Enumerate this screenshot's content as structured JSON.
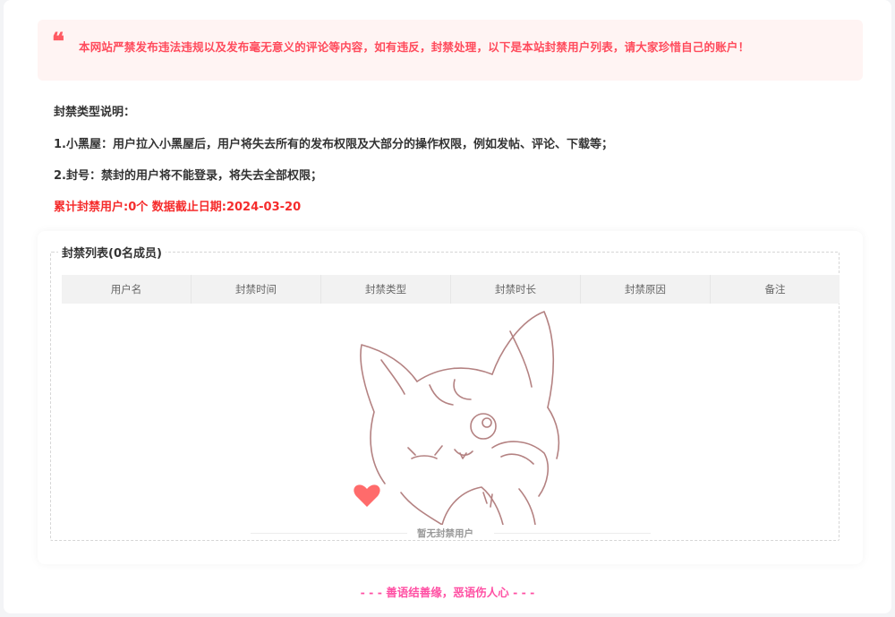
{
  "notice": {
    "icon": "quote-icon",
    "text": "本网站严禁发布违法违规以及发布毫无意义的评论等内容，如有违反，封禁处理，以下是本站封禁用户列表，请大家珍惜自己的账户！"
  },
  "description": {
    "heading": "封禁类型说明：",
    "item1": "1.小黑屋：用户拉入小黑屋后，用户将失去所有的发布权限及大部分的操作权限，例如发帖、评论、下载等；",
    "item2": "2.封号：禁封的用户将不能登录，将失去全部权限；",
    "summary": "累计封禁用户:0个 数据截止日期:2024-03-20"
  },
  "ban_list": {
    "title": "封禁列表(0名成员)",
    "columns": [
      "用户名",
      "封禁时间",
      "封禁类型",
      "封禁时长",
      "封禁原因",
      "备注"
    ],
    "rows": [],
    "empty_text": "暂无封禁用户"
  },
  "footer": {
    "text": "- - - 善语结善缘，恶语伤人心 - - -"
  },
  "colors": {
    "accent_red": "#ff4b5c",
    "summary_red": "#f52c2c",
    "footer_pink": "#ff4fa3",
    "heart": "#ff6b6b"
  }
}
